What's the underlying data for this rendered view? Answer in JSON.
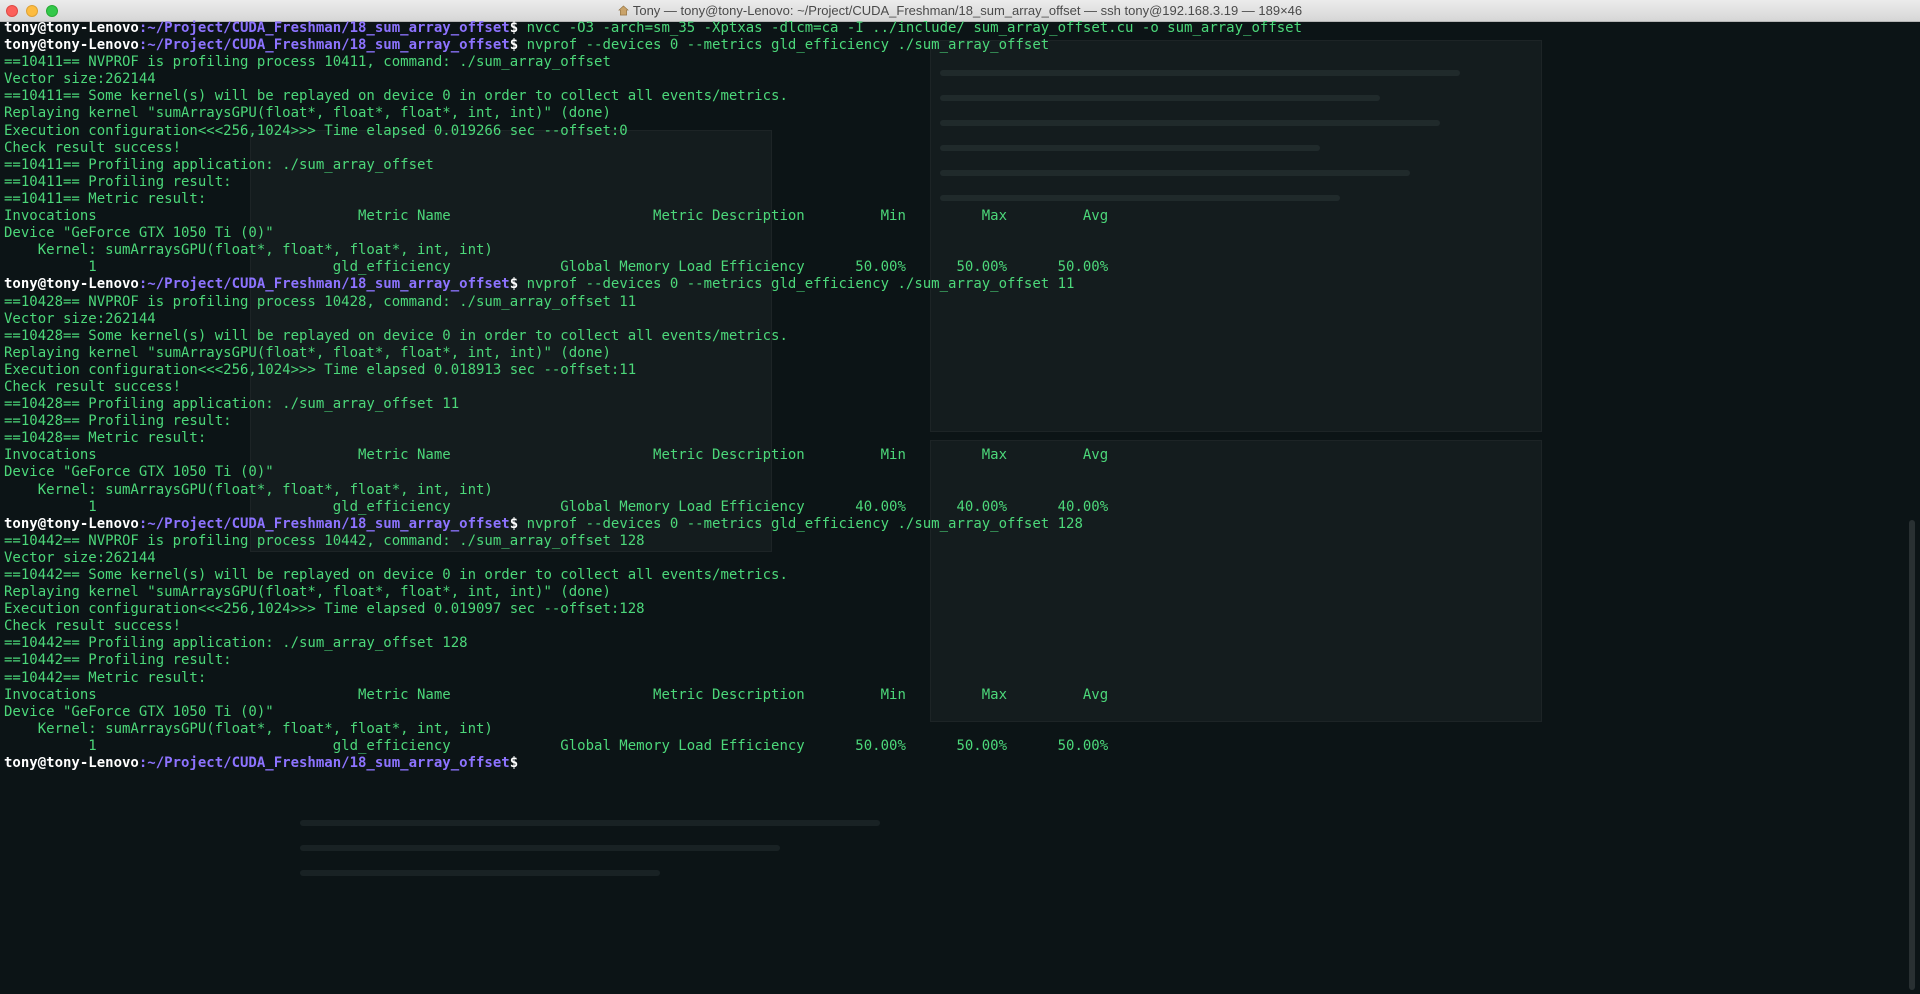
{
  "window": {
    "title": "Tony — tony@tony-Lenovo: ~/Project/CUDA_Freshman/18_sum_array_offset — ssh tony@192.168.3.19 — 189×46"
  },
  "prompt": {
    "user": "tony@tony-Lenovo",
    "path": ":~/Project/CUDA_Freshman/18_sum_array_offset",
    "sign": "$"
  },
  "lines": [
    {
      "type": "cmd",
      "text": " nvcc -O3 -arch=sm_35 -Xptxas -dlcm=ca -I ../include/ sum_array_offset.cu -o sum_array_offset"
    },
    {
      "type": "cmd",
      "text": " nvprof --devices 0 --metrics gld_efficiency ./sum_array_offset"
    },
    {
      "type": "out",
      "text": "==10411== NVPROF is profiling process 10411, command: ./sum_array_offset"
    },
    {
      "type": "out",
      "text": "Vector size:262144"
    },
    {
      "type": "out",
      "text": "==10411== Some kernel(s) will be replayed on device 0 in order to collect all events/metrics."
    },
    {
      "type": "out",
      "text": "Replaying kernel \"sumArraysGPU(float*, float*, float*, int, int)\" (done)"
    },
    {
      "type": "out",
      "text": "Execution configuration<<<256,1024>>> Time elapsed 0.019266 sec --offset:0"
    },
    {
      "type": "out",
      "text": "Check result success!"
    },
    {
      "type": "out",
      "text": "==10411== Profiling application: ./sum_array_offset"
    },
    {
      "type": "out",
      "text": "==10411== Profiling result:"
    },
    {
      "type": "out",
      "text": "==10411== Metric result:"
    },
    {
      "type": "out",
      "text": "Invocations                               Metric Name                        Metric Description         Min         Max         Avg"
    },
    {
      "type": "out",
      "text": "Device \"GeForce GTX 1050 Ti (0)\""
    },
    {
      "type": "out",
      "text": "    Kernel: sumArraysGPU(float*, float*, float*, int, int)"
    },
    {
      "type": "out",
      "text": "          1                            gld_efficiency             Global Memory Load Efficiency      50.00%      50.00%      50.00%"
    },
    {
      "type": "cmd",
      "text": " nvprof --devices 0 --metrics gld_efficiency ./sum_array_offset 11"
    },
    {
      "type": "out",
      "text": "==10428== NVPROF is profiling process 10428, command: ./sum_array_offset 11"
    },
    {
      "type": "out",
      "text": "Vector size:262144"
    },
    {
      "type": "out",
      "text": "==10428== Some kernel(s) will be replayed on device 0 in order to collect all events/metrics."
    },
    {
      "type": "out",
      "text": "Replaying kernel \"sumArraysGPU(float*, float*, float*, int, int)\" (done)"
    },
    {
      "type": "out",
      "text": "Execution configuration<<<256,1024>>> Time elapsed 0.018913 sec --offset:11"
    },
    {
      "type": "out",
      "text": "Check result success!"
    },
    {
      "type": "out",
      "text": "==10428== Profiling application: ./sum_array_offset 11"
    },
    {
      "type": "out",
      "text": "==10428== Profiling result:"
    },
    {
      "type": "out",
      "text": "==10428== Metric result:"
    },
    {
      "type": "out",
      "text": "Invocations                               Metric Name                        Metric Description         Min         Max         Avg"
    },
    {
      "type": "out",
      "text": "Device \"GeForce GTX 1050 Ti (0)\""
    },
    {
      "type": "out",
      "text": "    Kernel: sumArraysGPU(float*, float*, float*, int, int)"
    },
    {
      "type": "out",
      "text": "          1                            gld_efficiency             Global Memory Load Efficiency      40.00%      40.00%      40.00%"
    },
    {
      "type": "cmd",
      "text": " nvprof --devices 0 --metrics gld_efficiency ./sum_array_offset 128"
    },
    {
      "type": "out",
      "text": "==10442== NVPROF is profiling process 10442, command: ./sum_array_offset 128"
    },
    {
      "type": "out",
      "text": "Vector size:262144"
    },
    {
      "type": "out",
      "text": "==10442== Some kernel(s) will be replayed on device 0 in order to collect all events/metrics."
    },
    {
      "type": "out",
      "text": "Replaying kernel \"sumArraysGPU(float*, float*, float*, int, int)\" (done)"
    },
    {
      "type": "out",
      "text": "Execution configuration<<<256,1024>>> Time elapsed 0.019097 sec --offset:128"
    },
    {
      "type": "out",
      "text": "Check result success!"
    },
    {
      "type": "out",
      "text": "==10442== Profiling application: ./sum_array_offset 128"
    },
    {
      "type": "out",
      "text": "==10442== Profiling result:"
    },
    {
      "type": "out",
      "text": "==10442== Metric result:"
    },
    {
      "type": "out",
      "text": "Invocations                               Metric Name                        Metric Description         Min         Max         Avg"
    },
    {
      "type": "out",
      "text": "Device \"GeForce GTX 1050 Ti (0)\""
    },
    {
      "type": "out",
      "text": "    Kernel: sumArraysGPU(float*, float*, float*, int, int)"
    },
    {
      "type": "out",
      "text": "          1                            gld_efficiency             Global Memory Load Efficiency      50.00%      50.00%      50.00%"
    },
    {
      "type": "cmd",
      "text": " "
    }
  ],
  "colors": {
    "output": "#4cd87a",
    "prompt_path": "#8d73ff",
    "prompt_user": "#ffffff",
    "background": "#0c1416"
  }
}
